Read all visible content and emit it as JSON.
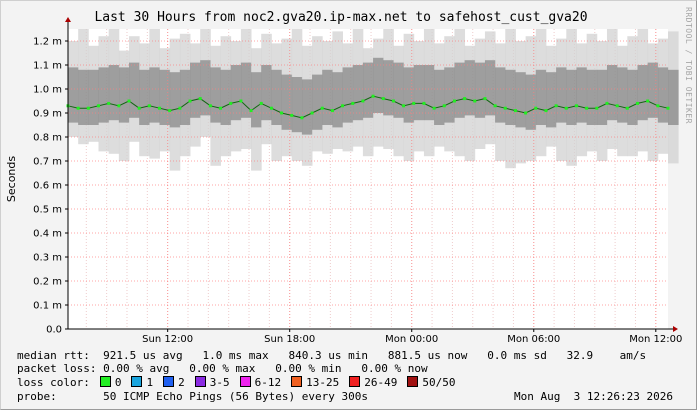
{
  "title": "Last 30 Hours from noc2.gva20.ip-max.net to safehost_cust_gva20",
  "watermark": "RRDTOOL / TOBI OETIKER",
  "chart_data": {
    "type": "line",
    "title": "Last 30 Hours from noc2.gva20.ip-max.net to safehost_cust_gva20",
    "xlabel": "",
    "ylabel": "Seconds",
    "ylim": [
      0,
      1.25
    ],
    "yticks": [
      0.0,
      0.1,
      0.2,
      0.3,
      0.4,
      0.5,
      0.6,
      0.7,
      0.8,
      0.9,
      1.0,
      1.1,
      1.2
    ],
    "ytick_labels": [
      "0.0",
      "0.1 m",
      "0.2 m",
      "0.3 m",
      "0.4 m",
      "0.5 m",
      "0.6 m",
      "0.7 m",
      "0.8 m",
      "0.9 m",
      "1.0 m",
      "1.1 m",
      "1.2 m"
    ],
    "xticks": [
      {
        "label": "Sun 12:00",
        "hour": 4.9
      },
      {
        "label": "Sun 18:00",
        "hour": 10.9
      },
      {
        "label": "Mon 00:00",
        "hour": 16.9
      },
      {
        "label": "Mon 06:00",
        "hour": 22.9
      },
      {
        "label": "Mon 12:00",
        "hour": 28.9
      }
    ],
    "x_range_hours": [
      0,
      29.5
    ],
    "grid": true,
    "series": [
      {
        "name": "median rtt",
        "color": "#22ee22",
        "x_hours": [
          0.0,
          0.5,
          1.0,
          1.5,
          2.0,
          2.5,
          3.0,
          3.5,
          4.0,
          4.5,
          5.0,
          5.5,
          6.0,
          6.5,
          7.0,
          7.5,
          8.0,
          8.5,
          9.0,
          9.5,
          10.0,
          10.5,
          11.0,
          11.5,
          12.0,
          12.5,
          13.0,
          13.5,
          14.0,
          14.5,
          15.0,
          15.5,
          16.0,
          16.5,
          17.0,
          17.5,
          18.0,
          18.5,
          19.0,
          19.5,
          20.0,
          20.5,
          21.0,
          21.5,
          22.0,
          22.5,
          23.0,
          23.5,
          24.0,
          24.5,
          25.0,
          25.5,
          26.0,
          26.5,
          27.0,
          27.5,
          28.0,
          28.5,
          29.0,
          29.5
        ],
        "values": [
          0.93,
          0.92,
          0.92,
          0.93,
          0.94,
          0.93,
          0.95,
          0.92,
          0.93,
          0.92,
          0.91,
          0.92,
          0.95,
          0.96,
          0.93,
          0.92,
          0.94,
          0.95,
          0.91,
          0.94,
          0.92,
          0.9,
          0.89,
          0.88,
          0.9,
          0.92,
          0.91,
          0.93,
          0.94,
          0.95,
          0.97,
          0.96,
          0.95,
          0.93,
          0.94,
          0.94,
          0.92,
          0.93,
          0.95,
          0.96,
          0.95,
          0.96,
          0.93,
          0.92,
          0.91,
          0.9,
          0.92,
          0.91,
          0.93,
          0.92,
          0.93,
          0.92,
          0.92,
          0.94,
          0.93,
          0.92,
          0.94,
          0.95,
          0.93,
          0.92
        ]
      }
    ],
    "smoke": {
      "min": [
        0.8,
        0.77,
        0.78,
        0.74,
        0.73,
        0.7,
        0.78,
        0.72,
        0.71,
        0.74,
        0.66,
        0.72,
        0.76,
        0.8,
        0.68,
        0.72,
        0.74,
        0.75,
        0.66,
        0.77,
        0.7,
        0.72,
        0.7,
        0.68,
        0.74,
        0.73,
        0.75,
        0.74,
        0.76,
        0.72,
        0.76,
        0.75,
        0.72,
        0.7,
        0.74,
        0.72,
        0.76,
        0.74,
        0.72,
        0.7,
        0.75,
        0.77,
        0.7,
        0.67,
        0.69,
        0.7,
        0.72,
        0.76,
        0.7,
        0.68,
        0.72,
        0.74,
        0.7,
        0.75,
        0.72,
        0.72,
        0.74,
        0.7,
        0.73,
        0.69
      ],
      "max": [
        1.2,
        1.25,
        1.18,
        1.22,
        1.25,
        1.16,
        1.22,
        1.19,
        1.25,
        1.17,
        1.21,
        1.23,
        1.19,
        1.25,
        1.18,
        1.22,
        1.2,
        1.25,
        1.17,
        1.23,
        1.19,
        1.21,
        1.25,
        1.18,
        1.22,
        1.2,
        1.24,
        1.19,
        1.25,
        1.17,
        1.21,
        1.25,
        1.18,
        1.23,
        1.2,
        1.25,
        1.19,
        1.22,
        1.25,
        1.18,
        1.21,
        1.24,
        1.19,
        1.25,
        1.2,
        1.22,
        1.25,
        1.18,
        1.21,
        1.25,
        1.19,
        1.23,
        1.2,
        1.25,
        1.18,
        1.22,
        1.25,
        1.19,
        1.21,
        1.24
      ]
    }
  },
  "stats": {
    "median_rtt_label": "median rtt:",
    "median_rtt_values": "  921.5 us avg   1.0 ms max   840.3 us min   881.5 us now   0.0 ms sd   32.9    am/s",
    "packet_loss_label": "packet loss:",
    "packet_loss_values": " 0.00 % avg   0.00 % max   0.00 % min   0.00 % now",
    "loss_color_label": "loss color:",
    "loss_colors": [
      {
        "label": "0",
        "color": "#22ee22"
      },
      {
        "label": "1",
        "color": "#1aa5de"
      },
      {
        "label": "2",
        "color": "#2060f0"
      },
      {
        "label": "3-5",
        "color": "#8a2be2"
      },
      {
        "label": "6-12",
        "color": "#ee22ee"
      },
      {
        "label": "13-25",
        "color": "#f06020"
      },
      {
        "label": "26-49",
        "color": "#f02020"
      },
      {
        "label": "50/50",
        "color": "#a01010"
      }
    ],
    "probe_label": "probe:",
    "probe_value": "       50 ICMP Echo Pings (56 Bytes) every 300s",
    "timestamp": "Mon Aug  3 12:26:23 2026"
  }
}
